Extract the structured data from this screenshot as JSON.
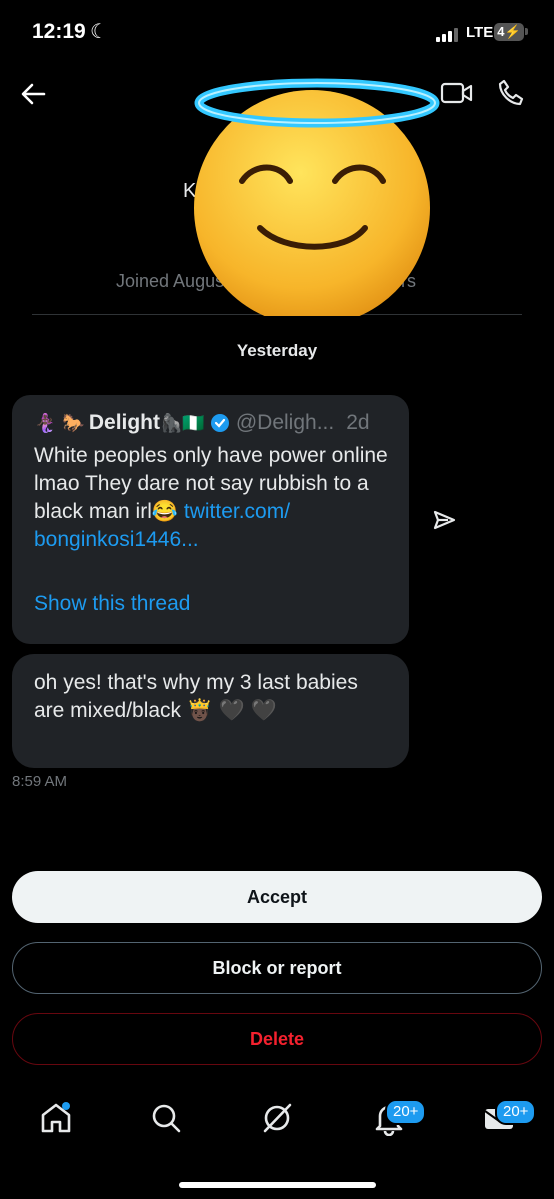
{
  "status": {
    "time": "12:19",
    "network": "LTE",
    "battery": "4"
  },
  "header": {
    "profile_name_partial": "K",
    "joined_partial": "Joined Augus",
    "followers_partial": "owers"
  },
  "conversation": {
    "date_label": "Yesterday",
    "quoted_tweet": {
      "name": "Delight",
      "name_emoji": "🦍🇳🇬",
      "handle": "@Deligh...",
      "age": "2d",
      "text": "White peoples only have power online lmao They dare not say rubbish to a black man irl😂",
      "link": "twitter.com/ bonginkosi1446...",
      "show_thread": "Show this thread"
    },
    "message": {
      "text": "oh yes!  that's why my 3 last babies are mixed/black  🤴🏿 🖤 🖤",
      "time": "8:59 AM"
    }
  },
  "actions": {
    "accept": "Accept",
    "block": "Block or report",
    "delete": "Delete"
  },
  "tabbar": {
    "notifications_badge": "20+",
    "messages_badge": "20+"
  },
  "colors": {
    "accent": "#1d9bf0",
    "danger": "#f4212e",
    "bubble": "#202327"
  }
}
